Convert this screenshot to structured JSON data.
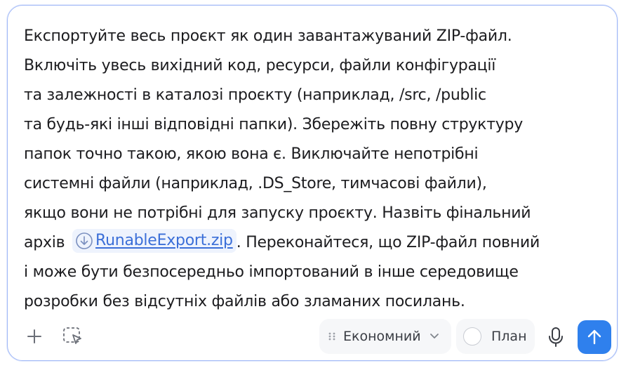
{
  "prompt": {
    "line1": "Експортуйте весь проєкт як один завантажуваний ZIP-файл.",
    "line2": "Включіть увесь вихідний код, ресурси, файли конфігурації",
    "line3": "та залежності в каталозі проєкту (наприклад, /src, /public",
    "line4": "та будь-які інші відповідні папки). Збережіть повну структуру",
    "line5": "папок точно такою, якою вона є. Виключайте непотрібні",
    "line6": "системні файли (наприклад, .DS_Store, тимчасові файли),",
    "line7": "якщо вони не потрібні для запуску проєкту. Назвіть фінальний",
    "line8_before": "архів",
    "file_name": "RunableExport.zip",
    "line8_after": ". Переконайтеся, що ZIP-файл повний",
    "line9": "і може бути безпосередньо імпортований в інше середовище",
    "line10": "розробки без відсутніх файлів або зламаних посилань."
  },
  "toolbar": {
    "mode_label": "Економний",
    "plan_label": "План",
    "plan_checked": false
  },
  "icons": {
    "attach": "plus-icon",
    "select": "selection-cursor-icon",
    "mode_grip": "grip-dots-icon",
    "mode_dropdown": "chevron-down-icon",
    "file": "download-circle-icon",
    "mic": "microphone-icon",
    "send": "arrow-up-icon"
  },
  "colors": {
    "accent": "#2f80ed",
    "link": "#3b6fd8",
    "border": "#9fb7f7"
  }
}
